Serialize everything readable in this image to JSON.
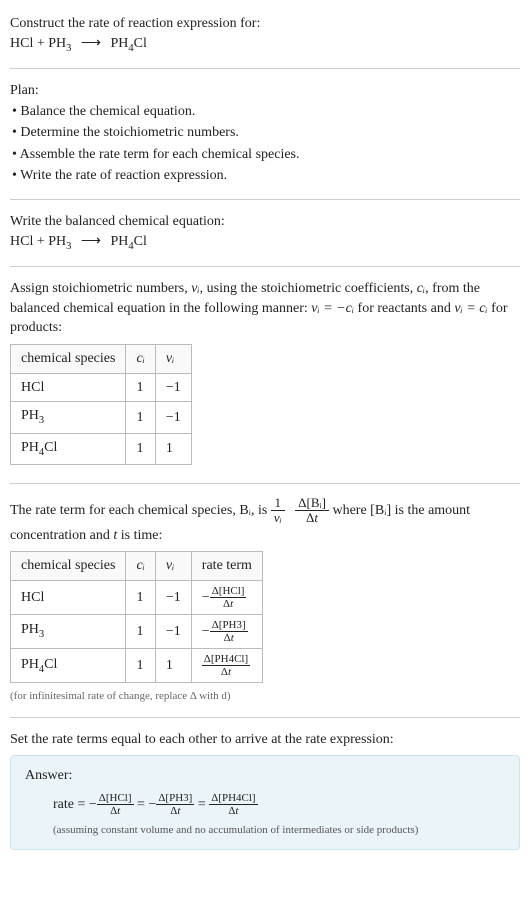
{
  "prompt": {
    "title": "Construct the rate of reaction expression for:",
    "equation_text": "HCl + PH3 ⟶ PH4Cl"
  },
  "plan": {
    "heading": "Plan:",
    "items": [
      "• Balance the chemical equation.",
      "• Determine the stoichiometric numbers.",
      "• Assemble the rate term for each chemical species.",
      "• Write the rate of reaction expression."
    ]
  },
  "balanced": {
    "heading": "Write the balanced chemical equation:",
    "equation_text": "HCl + PH3 ⟶ PH4Cl"
  },
  "stoich": {
    "text_a": "Assign stoichiometric numbers, ",
    "nu_i": "νᵢ",
    "text_b": ", using the stoichiometric coefficients, ",
    "c_i": "cᵢ",
    "text_c": ", from the balanced chemical equation in the following manner: ",
    "rel1": "νᵢ = −cᵢ",
    "text_d": " for reactants and ",
    "rel2": "νᵢ = cᵢ",
    "text_e": " for products:",
    "headers": {
      "species": "chemical species",
      "ci": "cᵢ",
      "nui": "νᵢ"
    },
    "rows": [
      {
        "species": "HCl",
        "ci": "1",
        "nui": "−1"
      },
      {
        "species": "PH3",
        "ci": "1",
        "nui": "−1"
      },
      {
        "species": "PH4Cl",
        "ci": "1",
        "nui": "1"
      }
    ]
  },
  "rateterm": {
    "text_a": "The rate term for each chemical species, ",
    "Bi": "Bᵢ",
    "text_b": ", is ",
    "frac1_num": "1",
    "frac1_den": "νᵢ",
    "frac2_num": "Δ[Bᵢ]",
    "frac2_den": "Δt",
    "text_c": " where ",
    "conc": "[Bᵢ]",
    "text_d": " is the amount concentration and ",
    "t": "t",
    "text_e": " is time:",
    "headers": {
      "species": "chemical species",
      "ci": "cᵢ",
      "nui": "νᵢ",
      "rate": "rate term"
    },
    "rows": [
      {
        "species": "HCl",
        "ci": "1",
        "nui": "−1",
        "neg": "−",
        "num": "Δ[HCl]",
        "den": "Δt"
      },
      {
        "species": "PH3",
        "ci": "1",
        "nui": "−1",
        "neg": "−",
        "num": "Δ[PH3]",
        "den": "Δt"
      },
      {
        "species": "PH4Cl",
        "ci": "1",
        "nui": "1",
        "neg": "",
        "num": "Δ[PH4Cl]",
        "den": "Δt"
      }
    ],
    "footnote": "(for infinitesimal rate of change, replace Δ with d)"
  },
  "final": {
    "heading": "Set the rate terms equal to each other to arrive at the rate expression:",
    "answer_label": "Answer:",
    "rate_label": "rate = ",
    "t1_neg": "−",
    "t1_num": "Δ[HCl]",
    "t1_den": "Δt",
    "eq": " = ",
    "t2_neg": "−",
    "t2_num": "Δ[PH3]",
    "t2_den": "Δt",
    "t3_neg": "",
    "t3_num": "Δ[PH4Cl]",
    "t3_den": "Δt",
    "note": "(assuming constant volume and no accumulation of intermediates or side products)"
  },
  "chart_data": {
    "type": "table",
    "tables": [
      {
        "title": "Stoichiometric numbers",
        "columns": [
          "chemical species",
          "cᵢ",
          "νᵢ"
        ],
        "rows": [
          [
            "HCl",
            1,
            -1
          ],
          [
            "PH3",
            1,
            -1
          ],
          [
            "PH4Cl",
            1,
            1
          ]
        ]
      },
      {
        "title": "Rate terms",
        "columns": [
          "chemical species",
          "cᵢ",
          "νᵢ",
          "rate term"
        ],
        "rows": [
          [
            "HCl",
            1,
            -1,
            "−Δ[HCl]/Δt"
          ],
          [
            "PH3",
            1,
            -1,
            "−Δ[PH3]/Δt"
          ],
          [
            "PH4Cl",
            1,
            1,
            "Δ[PH4Cl]/Δt"
          ]
        ]
      }
    ],
    "rate_expression": "rate = −Δ[HCl]/Δt = −Δ[PH3]/Δt = Δ[PH4Cl]/Δt"
  }
}
